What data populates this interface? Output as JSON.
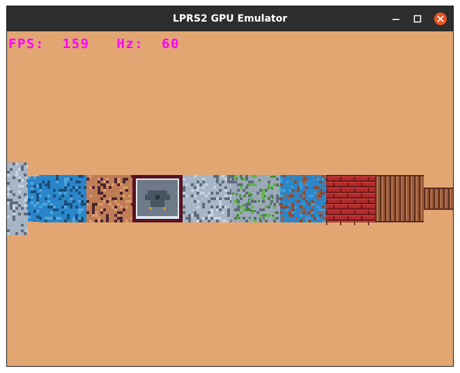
{
  "window": {
    "title": "LPRS2 GPU Emulator",
    "controls": [
      "minimize-icon",
      "maximize-icon",
      "close-icon"
    ],
    "close_color": "#e95420"
  },
  "hud": {
    "fps_label": "FPS:",
    "fps_value": "159",
    "hz_label": "Hz:",
    "hz_value": "60",
    "color": "#ff00ff"
  },
  "scene": {
    "background_color": "#e2a672",
    "wall_textures": [
      "grey-stone",
      "blue-stone",
      "brown-cobblestone",
      "eagle-emblem",
      "grey-stone",
      "mossy-stone",
      "blue-mossy-stone",
      "red-brick",
      "wood-planks",
      "wood-planks"
    ]
  }
}
